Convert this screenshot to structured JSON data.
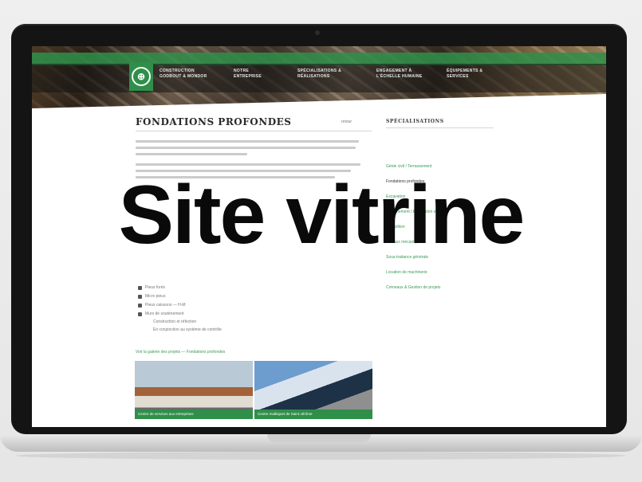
{
  "site": {
    "nav": [
      {
        "label": "CONSTRUCTION GODBOUT & MONDOR",
        "x": "l"
      },
      {
        "label": "NOTRE ENTREPRISE"
      },
      {
        "label": "SPÉCIALISATIONS & RÉALISATIONS"
      },
      {
        "label": "ENGAGEMENT À L'ÉCHELLE HUMAINE"
      },
      {
        "label": "ÉQUIPEMENTS & SERVICES"
      }
    ],
    "page_title": "FONDATIONS PROFONDES",
    "retour": "retour",
    "bullets": [
      "Pieux forés",
      "Micro pieux",
      "Pieux caissons — H-M",
      "Murs de soutènement"
    ],
    "sub_bullets": [
      "Construction et réfection",
      "En conjonction au système de contrôle"
    ],
    "gallery_link": "Voir la galerie des projets — Fondations profondes",
    "photos": [
      {
        "caption": "Centre de services aux entreprises"
      },
      {
        "caption": "Centre multisport de Saint-Jérôme"
      }
    ],
    "sidebar": {
      "title": "SPÉCIALISATIONS",
      "items": [
        {
          "label": "Génie civil / Terrassement",
          "active": false
        },
        {
          "label": "Fondations profondes",
          "active": true
        },
        {
          "label": "Excavation",
          "active": false
        },
        {
          "label": "Soutènement / Excavation en cours",
          "active": false
        },
        {
          "label": "Démolition",
          "active": false
        },
        {
          "label": "Travaux mécaniques",
          "active": false
        },
        {
          "label": "Sous-traitance générale",
          "active": false
        },
        {
          "label": "Location de machinerie",
          "active": false
        },
        {
          "label": "Créneaux & Gestion de projets",
          "active": false
        }
      ]
    }
  },
  "overlay": {
    "text": "Site vitrine"
  },
  "colors": {
    "brand_green": "#2f8f4a",
    "laptop_bezel": "#141414"
  }
}
